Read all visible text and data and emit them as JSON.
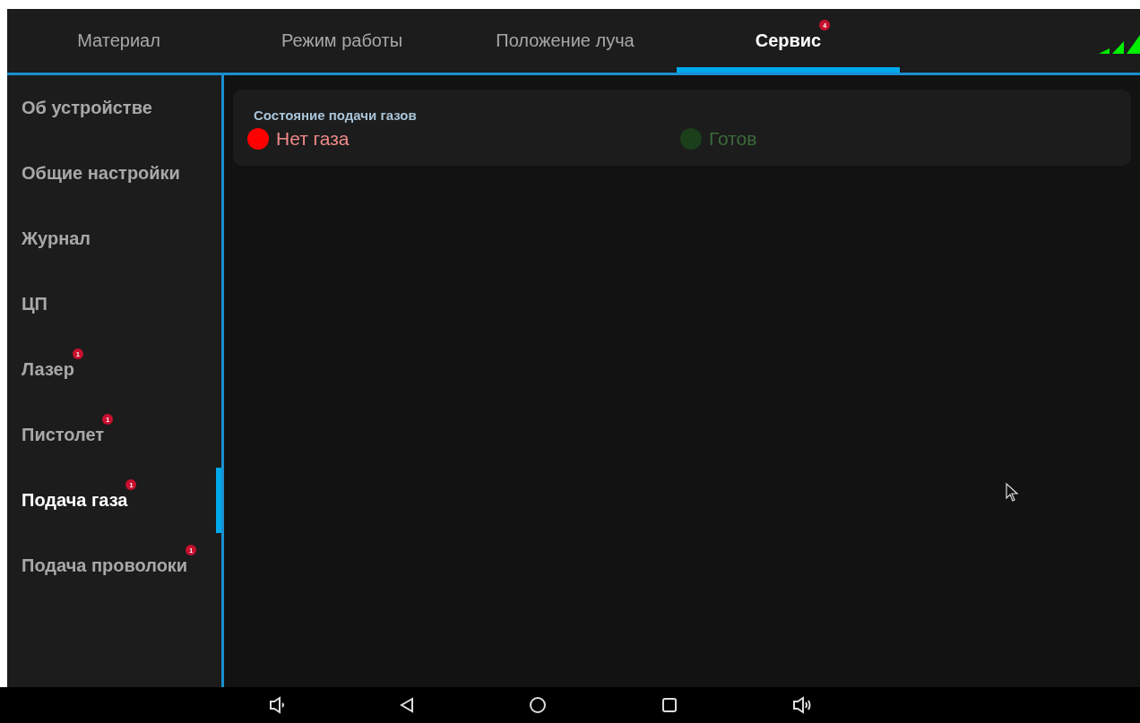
{
  "tabs": [
    {
      "label": "Материал",
      "selected": false
    },
    {
      "label": "Режим работы",
      "selected": false
    },
    {
      "label": "Положение луча",
      "selected": false
    },
    {
      "label": "Сервис",
      "selected": true,
      "badge": "4"
    }
  ],
  "sidebar": {
    "items": [
      {
        "label": "Об устройстве",
        "selected": false
      },
      {
        "label": "Общие настройки",
        "selected": false
      },
      {
        "label": "Журнал",
        "selected": false
      },
      {
        "label": "ЦП",
        "selected": false
      },
      {
        "label": "Лазер",
        "selected": false,
        "badge": "1"
      },
      {
        "label": "Пистолет",
        "selected": false,
        "badge": "1"
      },
      {
        "label": "Подача газа",
        "selected": true,
        "badge": "1"
      },
      {
        "label": "Подача проволоки",
        "selected": false,
        "badge": "1"
      }
    ]
  },
  "gas_status": {
    "title": "Состояние подачи газов",
    "indicators": [
      {
        "label": "Нет газа",
        "active": true,
        "color": "#ff0000"
      },
      {
        "label": "Готов",
        "active": false,
        "color": "#1a3f1a"
      }
    ]
  }
}
